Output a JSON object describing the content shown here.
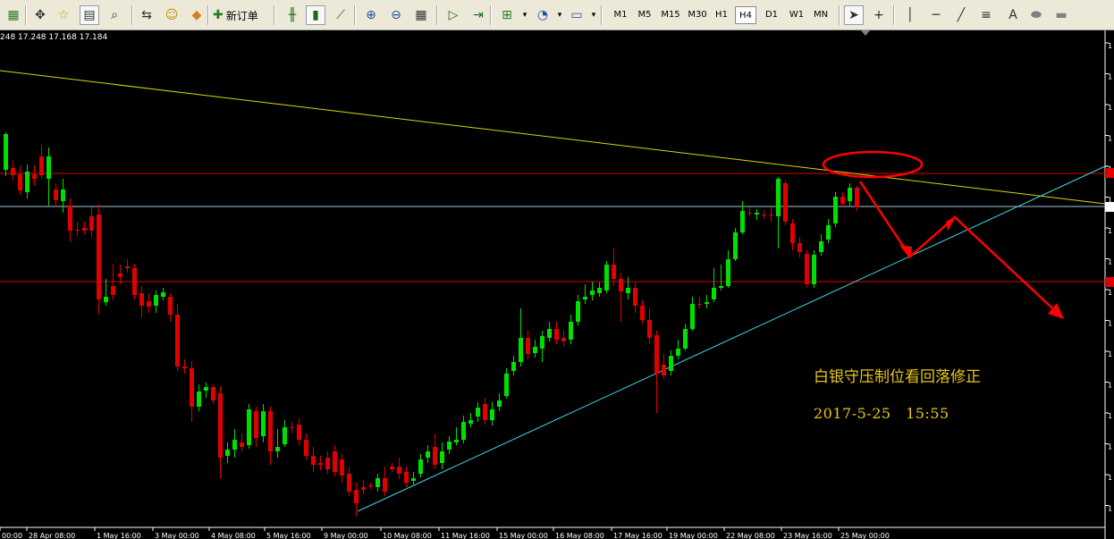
{
  "toolbar": {
    "new_order_label": "新订单",
    "timeframes": [
      "M1",
      "M5",
      "M15",
      "M30",
      "H1",
      "H4",
      "D1",
      "W1",
      "MN"
    ],
    "active_timeframe": "H4",
    "icons": [
      "new-chart-icon",
      "crosshair-icon",
      "favorites-icon",
      "navigator-icon",
      "tester-icon",
      "market-watch-icon",
      "experts-icon",
      "autotrading-icon",
      "new-order-icon",
      "bar-chart-icon",
      "candlestick-icon",
      "line-chart-icon",
      "zoom-in-icon",
      "zoom-out-icon",
      "tile-windows-icon",
      "autoscroll-icon",
      "chart-shift-icon",
      "indicators-icon",
      "periods-icon",
      "templates-icon",
      "cursor-icon",
      "crosshair-cursor-icon",
      "vertical-line-icon",
      "horizontal-line-icon",
      "trendline-icon",
      "fibonacci-icon",
      "text-icon",
      "ellipse-icon",
      "rectangle-icon"
    ]
  },
  "chart": {
    "ohlc_text": "248 17.248 17.168 17.184",
    "annotation_title": "白银守压制位看回落修正",
    "annotation_datetime": "2017-5-25　15:55",
    "x_axis_labels": [
      "00:00",
      "28 Apr 08:00",
      "1 May 16:00",
      "3 May 00:00",
      "4 May 08:00",
      "5 May 16:00",
      "9 May 00:00",
      "10 May 08:00",
      "11 May 16:00",
      "15 May 00:00",
      "16 May 08:00",
      "17 May 16:00",
      "19 May 00:00",
      "22 May 08:00",
      "23 May 16:00",
      "25 May 00:00"
    ],
    "colors": {
      "background": "#000000",
      "bull_candle": "#00e000",
      "bear_candle": "#e00000",
      "resistance_trendline": "#d8d800",
      "support_trendline": "#40d8e8",
      "horizontal_levels": "#e00000",
      "current_price_line": "#a0c8e0",
      "annotation": "#e6c619",
      "forecast_arrows": "#ff0000"
    }
  }
}
